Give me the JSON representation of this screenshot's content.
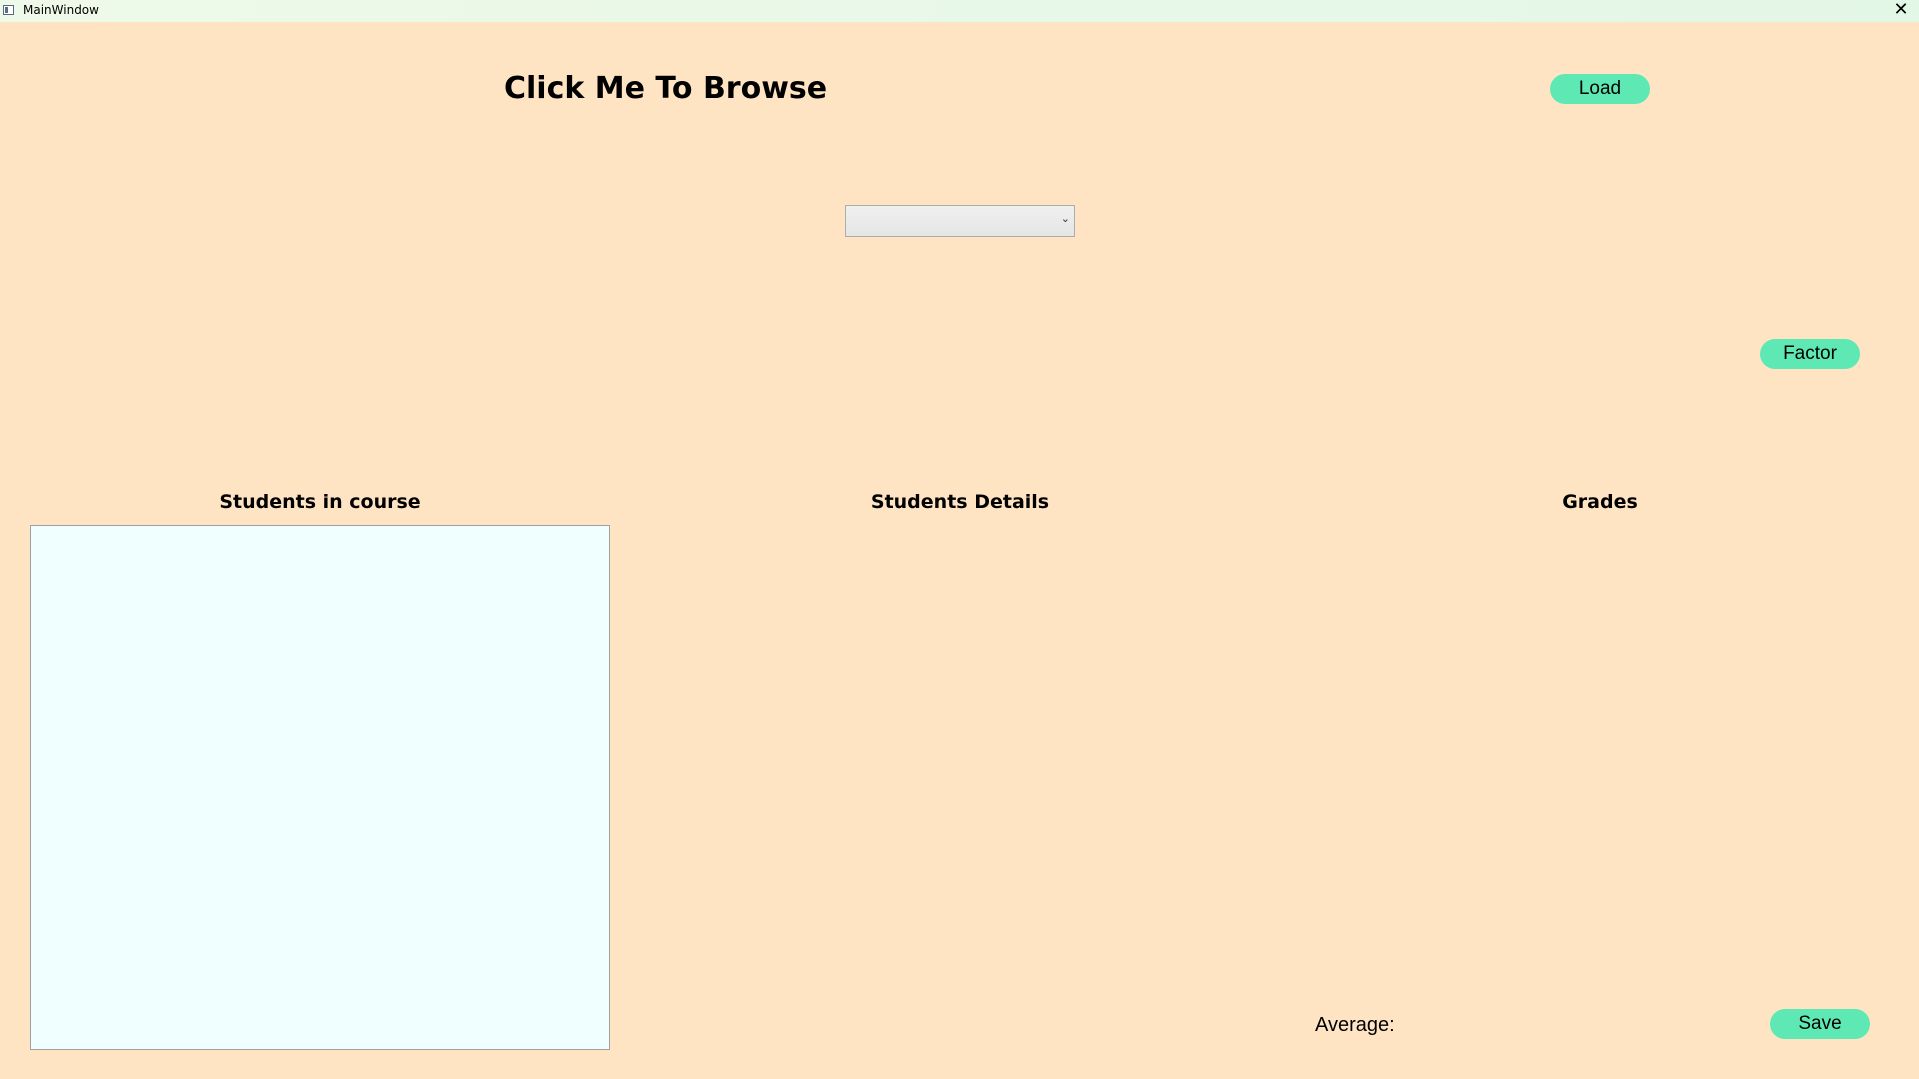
{
  "window": {
    "title": "MainWindow",
    "close_glyph": "✕",
    "background": "#FFE4C4"
  },
  "browse": {
    "label": "Click Me To Browse"
  },
  "buttons": {
    "load_label": "Load",
    "factor_label": "Factor",
    "save_label": "Save",
    "accent": "#5DE8B4"
  },
  "combo": {
    "selected_value": "",
    "arrow_glyph": "⌄"
  },
  "sections": {
    "students_in_course": "Students in course",
    "students_details": "Students Details",
    "grades": "Grades"
  },
  "students_list": {
    "items": [],
    "background": "#F0FFFF"
  },
  "average": {
    "label": "Average:",
    "value": ""
  }
}
